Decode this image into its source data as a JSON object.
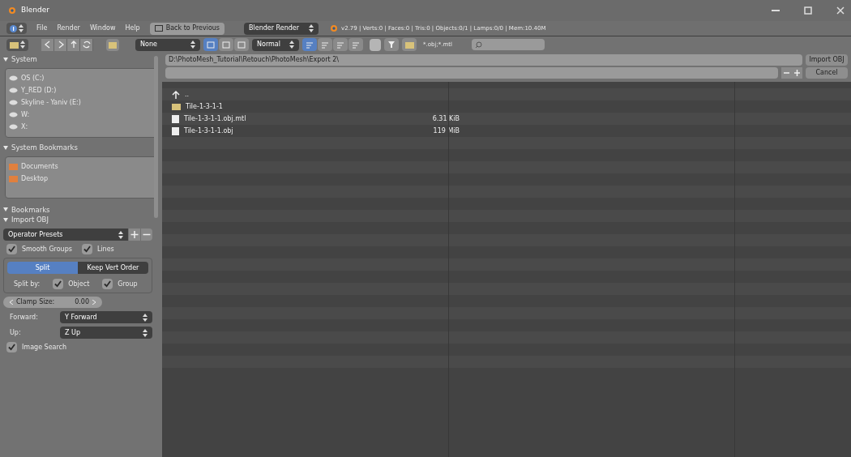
{
  "window": {
    "title": "Blender"
  },
  "menu_bar": {
    "items": [
      "File",
      "Render",
      "Window",
      "Help"
    ],
    "back_button": "Back to Previous",
    "engine": "Blender Render",
    "stats": "v2.79 | Verts:0 | Faces:0 | Tris:0 | Objects:0/1 | Lamps:0/0 | Mem:10.40M"
  },
  "toolbar": {
    "recursion": "None",
    "display_modes": [
      {
        "selected": true
      },
      {
        "selected": false
      },
      {
        "selected": false
      }
    ],
    "thumbnail_size": "Normal",
    "sort_modes": [
      {
        "selected": true
      },
      {
        "selected": false
      },
      {
        "selected": false
      },
      {
        "selected": false
      }
    ],
    "filter_on": true,
    "filter_text": "*.obj;*.mtl"
  },
  "path": "D:\\PhotoMesh_Tutorial\\Retouch\\PhotoMesh\\Export 2\\",
  "buttons": {
    "import": "Import OBJ",
    "cancel": "Cancel"
  },
  "sidebar": {
    "sections": [
      {
        "title": "System",
        "items": [
          "OS (C:)",
          "Y_RED (D:)",
          "Skyline - Yaniv (E:)",
          "W:",
          "X:"
        ],
        "kind": "drive"
      },
      {
        "title": "System Bookmarks",
        "items": [
          "Documents",
          "Desktop"
        ],
        "kind": "folder"
      }
    ],
    "bookmarks_title": "Bookmarks",
    "import_title": "Import OBJ",
    "presets": "Operator Presets",
    "smooth_groups": {
      "label": "Smooth Groups",
      "checked": true
    },
    "lines": {
      "label": "Lines",
      "checked": true
    },
    "split_modes": [
      {
        "label": "Split",
        "selected": true
      },
      {
        "label": "Keep Vert Order",
        "selected": false
      }
    ],
    "split_by_label": "Split by:",
    "object": {
      "label": "Object",
      "checked": true
    },
    "group": {
      "label": "Group",
      "checked": true
    },
    "clamp": {
      "label": "Clamp Size:",
      "value": "0.00"
    },
    "forward": {
      "label": "Forward:",
      "value": "Y Forward"
    },
    "up": {
      "label": "Up:",
      "value": "Z Up"
    },
    "image_search": {
      "label": "Image Search",
      "checked": true
    }
  },
  "files": [
    {
      "kind": "parent",
      "name": ".."
    },
    {
      "kind": "folder",
      "name": "Tile-1-3-1-1"
    },
    {
      "kind": "file",
      "name": "Tile-1-3-1-1.obj.mtl",
      "size": "6.31 KiB"
    },
    {
      "kind": "file",
      "name": "Tile-1-3-1-1.obj",
      "size": "119 MiB"
    }
  ]
}
